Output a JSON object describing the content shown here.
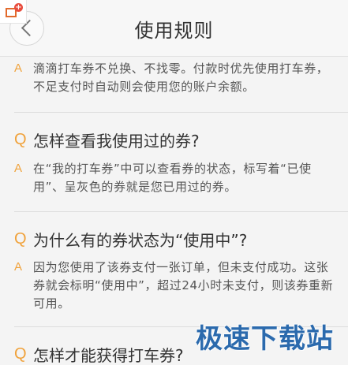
{
  "header": {
    "title": "使用规则",
    "back_icon": "chevron-left-icon",
    "badge_icon": "window-plus-icon",
    "badge_symbol": "+"
  },
  "markers": {
    "question": "Q",
    "answer": "A"
  },
  "faq": [
    {
      "question": "",
      "answer": "滴滴打车券不兑换、不找零。付款时优先使用打车券，不足支付时自动则会使用您的账户余额。"
    },
    {
      "question": "怎样查看我使用过的券?",
      "answer": "在“我的打车券”中可以查看券的状态，标写着“已使用”、呈灰色的券就是您已用过的券。"
    },
    {
      "question": "为什么有的券状态为“使用中”?",
      "answer": "因为您使用了该券支付一张订单，但未支付成功。这张券就会标明“使用中”，超过24小时未支付，则该券重新可用。"
    },
    {
      "question": "怎样才能获得打车券?",
      "answer": ""
    }
  ],
  "watermark": "极速下载站",
  "colors": {
    "accent": "#f0a23b",
    "watermark": "#1b5fa8",
    "badge": "#e84c3d"
  }
}
